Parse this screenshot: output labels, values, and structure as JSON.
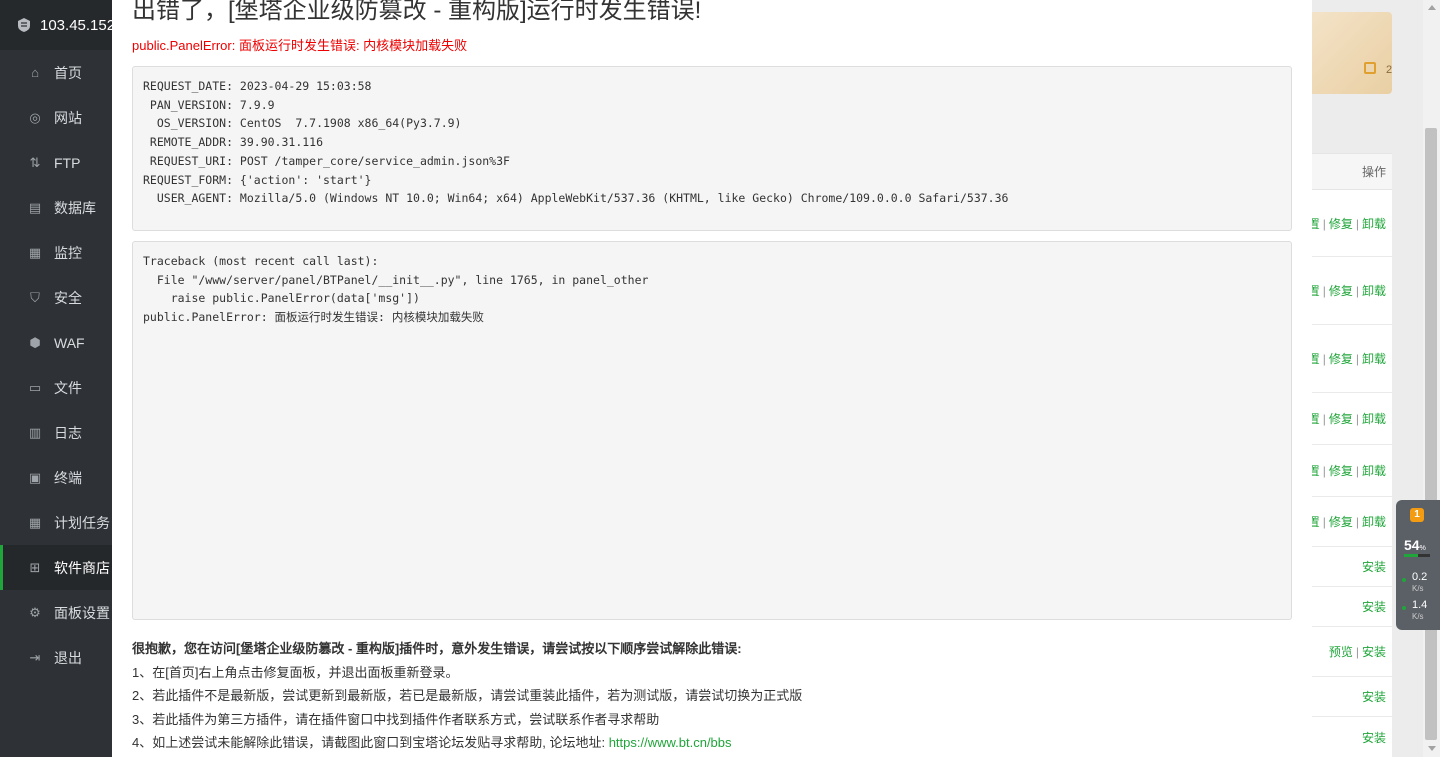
{
  "sidebar": {
    "server_ip": "103.45.152",
    "items": [
      {
        "label": "首页",
        "icon": "home-icon"
      },
      {
        "label": "网站",
        "icon": "globe-icon"
      },
      {
        "label": "FTP",
        "icon": "ftp-icon"
      },
      {
        "label": "数据库",
        "icon": "database-icon"
      },
      {
        "label": "监控",
        "icon": "monitor-icon"
      },
      {
        "label": "安全",
        "icon": "shield-icon"
      },
      {
        "label": "WAF",
        "icon": "waf-shield-icon"
      },
      {
        "label": "文件",
        "icon": "folder-icon"
      },
      {
        "label": "日志",
        "icon": "log-icon"
      },
      {
        "label": "终端",
        "icon": "terminal-icon"
      },
      {
        "label": "计划任务",
        "icon": "calendar-icon"
      },
      {
        "label": "软件商店",
        "icon": "grid-icon"
      },
      {
        "label": "面板设置",
        "icon": "gear-icon"
      },
      {
        "label": "退出",
        "icon": "logout-icon"
      }
    ],
    "active_index": 11
  },
  "modal": {
    "title": "出错了，[堡塔企业级防篡改 - 重构版]运行时发生错误!",
    "subtitle": "public.PanelError: 面板运行时发生错误: 内核模块加载失败",
    "request_info": [
      "REQUEST_DATE: 2023-04-29 15:03:58",
      " PAN_VERSION: 7.9.9",
      "  OS_VERSION: CentOS  7.7.1908 x86_64(Py3.7.9)",
      " REMOTE_ADDR: 39.90.31.116",
      " REQUEST_URI: POST /tamper_core/service_admin.json%3F",
      "REQUEST_FORM: {'action': 'start'}",
      "  USER_AGENT: Mozilla/5.0 (Windows NT 10.0; Win64; x64) AppleWebKit/537.36 (KHTML, like Gecko) Chrome/109.0.0.0 Safari/537.36"
    ],
    "traceback": [
      "Traceback (most recent call last):",
      "  File \"/www/server/panel/BTPanel/__init__.py\", line 1765, in panel_other",
      "    raise public.PanelError(data['msg'])",
      "public.PanelError: 面板运行时发生错误: 内核模块加载失败"
    ],
    "help_lead": "很抱歉，您在访问[堡塔企业级防篡改 - 重构版]插件时，意外发生错误，请尝试按以下顺序尝试解除此错误:",
    "help_steps": [
      "1、在[首页]右上角点击修复面板，并退出面板重新登录。",
      "2、若此插件不是最新版，尝试更新到最新版，若已是最新版，请尝试重装此插件，若为测试版，请尝试切换为正式版",
      "3、若此插件为第三方插件，请在插件窗口中找到插件作者联系方式，尝试联系作者寻求帮助",
      "4、如上述尝试未能解除此错误，请截图此窗口到宝塔论坛发贴寻求帮助, 论坛地址: "
    ],
    "forum_link": "https://www.bt.cn/bbs"
  },
  "background": {
    "card_text": "2",
    "table_header": "操作",
    "rows": [
      {
        "links": [
          "置",
          "修复",
          "卸载"
        ]
      },
      {
        "links": [
          "置",
          "修复",
          "卸载"
        ]
      },
      {
        "links": [
          "置",
          "修复",
          "卸载"
        ]
      },
      {
        "links": [
          "置",
          "修复",
          "卸载"
        ]
      },
      {
        "links": [
          "置",
          "修复",
          "卸载"
        ]
      },
      {
        "links": [
          "置",
          "修复",
          "卸载"
        ]
      },
      {
        "links": [
          "安装"
        ]
      },
      {
        "links": [
          "安装"
        ]
      },
      {
        "links": [
          "预览",
          "安装"
        ]
      },
      {
        "links": [
          "安装"
        ]
      },
      {
        "links": [
          "安装"
        ]
      }
    ]
  },
  "widget": {
    "badge": "1",
    "cpu_percent": "54",
    "cpu_unit": "%",
    "cpu_fill": 0.54,
    "up_value": "0.2",
    "up_unit": "K/s",
    "down_value": "1.4",
    "down_unit": "K/s"
  },
  "colors": {
    "accent": "#20a53a",
    "error": "#e00000",
    "sidebar_bg": "#2e3236"
  }
}
